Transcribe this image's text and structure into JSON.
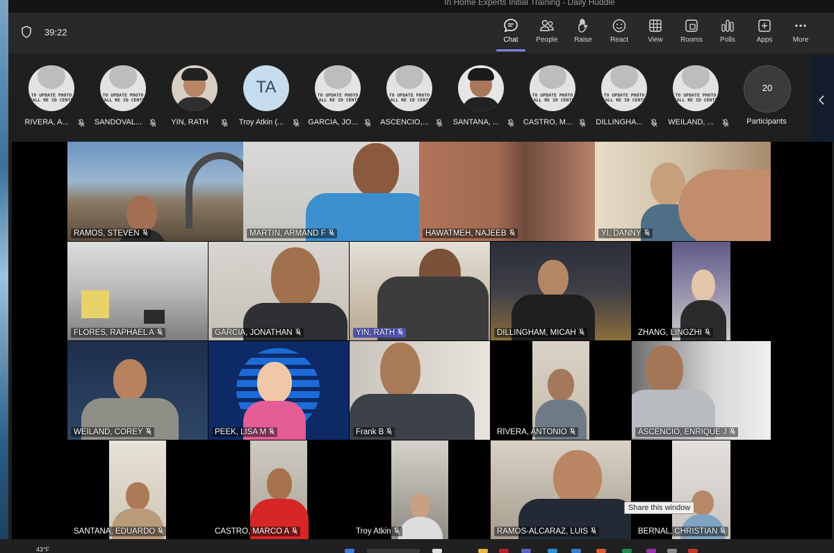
{
  "window": {
    "title": "In Home Experts Initial Training - Daily Huddle",
    "timer": "39:22"
  },
  "toolbar": [
    {
      "id": "chat",
      "label": "Chat",
      "icon": "chat-icon",
      "active": true
    },
    {
      "id": "people",
      "label": "People",
      "icon": "people-icon"
    },
    {
      "id": "raise",
      "label": "Raise",
      "icon": "raise-hand-icon"
    },
    {
      "id": "react",
      "label": "React",
      "icon": "react-icon"
    },
    {
      "id": "view",
      "label": "View",
      "icon": "view-grid-icon"
    },
    {
      "id": "rooms",
      "label": "Rooms",
      "icon": "rooms-icon"
    },
    {
      "id": "polls",
      "label": "Polls",
      "icon": "polls-icon"
    },
    {
      "id": "apps",
      "label": "Apps",
      "icon": "apps-plus-icon"
    },
    {
      "id": "more",
      "label": "More",
      "icon": "more-icon"
    }
  ],
  "strip": {
    "participants": [
      {
        "name": "RIVERA, A...",
        "avatar": "placeholder",
        "placeholder_text": "TO UPDATE PHOTO CALL RE ID CENTE"
      },
      {
        "name": "SANDOVAL...",
        "avatar": "placeholder",
        "placeholder_text": "TO UPDATE PHOTO CALL RE ID CENTE"
      },
      {
        "name": "YIN, RATH",
        "avatar": "photo"
      },
      {
        "name": "Troy Atkin (...",
        "avatar": "initials",
        "initials": "TA"
      },
      {
        "name": "GARCIA, JO...",
        "avatar": "placeholder",
        "placeholder_text": "TO UPDATE PHOTO CALL RE ID CENTE"
      },
      {
        "name": "ASCENCIO,...",
        "avatar": "placeholder",
        "placeholder_text": "TO UPDATE PHOTO CALL RE ID CENTE"
      },
      {
        "name": "SANTANA, ...",
        "avatar": "photo"
      },
      {
        "name": "CASTRO, M...",
        "avatar": "placeholder",
        "placeholder_text": "TO UPDATE PHOTO CALL RE ID CENTE"
      },
      {
        "name": "DILLINGHA...",
        "avatar": "placeholder",
        "placeholder_text": "TO UPDATE PHOTO CALL RE ID CENTE"
      },
      {
        "name": "WEILAND, ...",
        "avatar": "placeholder",
        "placeholder_text": "TO UPDATE PHOTO CALL RE ID CENTE"
      }
    ],
    "count": "20",
    "count_label": "Participants"
  },
  "tiles": [
    {
      "name": "RAMOS, STEVEN"
    },
    {
      "name": "MARTIN, ARMAND F"
    },
    {
      "name": "HAWATMEH, NAJEEB"
    },
    {
      "name": "YI, DANNY"
    },
    {
      "name": "FLORES, RAPHAEL A"
    },
    {
      "name": "GARCIA, JONATHAN"
    },
    {
      "name": "YIN, RATH",
      "speaking": true
    },
    {
      "name": "DILLINGHAM, MICAH"
    },
    {
      "name": "ZHANG, LINGZHI"
    },
    {
      "name": "WEILAND, COREY"
    },
    {
      "name": "PEEK, LISA M"
    },
    {
      "name": "Frank B"
    },
    {
      "name": "RIVERA, ANTONIO"
    },
    {
      "name": "ASCENCIO, ENRIQUE J"
    },
    {
      "name": "SANTANA, EDUARDO"
    },
    {
      "name": "CASTRO, MARCO A"
    },
    {
      "name": "Troy Atkin"
    },
    {
      "name": "RAMOS-ALCARAZ, LUIS"
    },
    {
      "name": "BERNAL, CHRISTIAN"
    }
  ],
  "tooltip": "Share this window",
  "taskbar": {
    "weather": "43°F"
  },
  "colors": {
    "accent": "#7f85f5",
    "speaking": "#4f52b2",
    "toolbar_bg": "#292929",
    "gallery_bg": "#000000"
  }
}
